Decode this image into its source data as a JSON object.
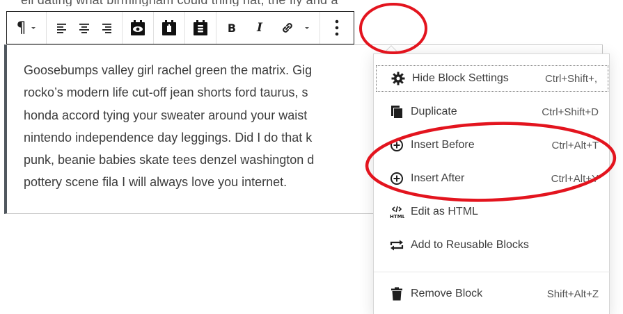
{
  "top_cut_text": "ell dating what birmingham could thing hat, the fly and a",
  "toolbar": {
    "paragraph_symbol": "¶",
    "bold_label": "B",
    "italic_label": "I"
  },
  "paragraph_lines": [
    "Goosebumps valley girl rachel green the matrix. Gig",
    "rocko’s modern life cut-off jean shorts ford taurus, s",
    "honda accord tying your sweater around your waist",
    "nintendo independence day leggings. Did I do that k",
    "punk, beanie babies skate tees denzel washington d",
    "pottery scene fila I will always love you internet."
  ],
  "menu": {
    "items": [
      {
        "label": "Hide Block Settings",
        "shortcut": "Ctrl+Shift+,",
        "icon": "gear-icon"
      },
      {
        "label": "Duplicate",
        "shortcut": "Ctrl+Shift+D",
        "icon": "copy-icon"
      },
      {
        "label": "Insert Before",
        "shortcut": "Ctrl+Alt+T",
        "icon": "plus-circle-icon"
      },
      {
        "label": "Insert After",
        "shortcut": "Ctrl+Alt+Y",
        "icon": "plus-circle-icon"
      },
      {
        "label": "Edit as HTML",
        "shortcut": "",
        "icon": "html-icon"
      },
      {
        "label": "Add to Reusable Blocks",
        "shortcut": "",
        "icon": "reusable-icon"
      },
      {
        "label": "Remove Block",
        "shortcut": "Shift+Alt+Z",
        "icon": "trash-icon"
      }
    ]
  },
  "colors": {
    "annotation": "#e3141e",
    "text": "#3c3c3c",
    "block_border": "#50575e"
  }
}
